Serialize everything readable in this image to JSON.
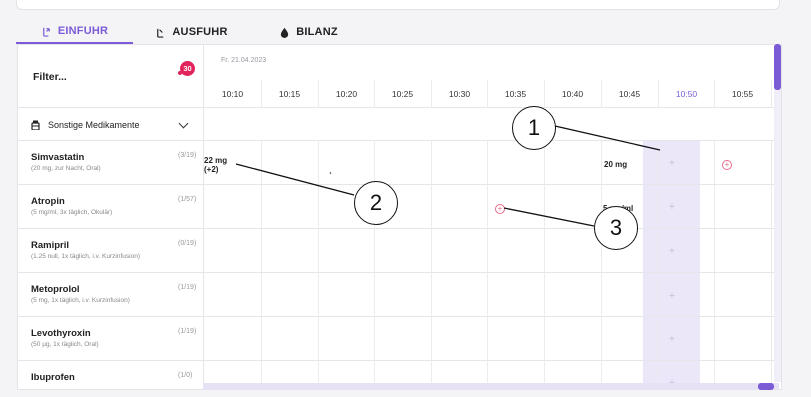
{
  "tabs": [
    {
      "label": "EINFUHR",
      "icon": "intake-icon",
      "active": true
    },
    {
      "label": "AUSFUHR",
      "icon": "output-icon",
      "active": false
    },
    {
      "label": "BILANZ",
      "icon": "drop-icon",
      "active": false
    }
  ],
  "filter": {
    "label": "Filter...",
    "badge": "30"
  },
  "date": "Fr. 21.04.2023",
  "times": [
    "10:10",
    "10:15",
    "10:20",
    "10:25",
    "10:30",
    "10:35",
    "10:40",
    "10:45",
    "10:50",
    "10:55"
  ],
  "active_time": "10:50",
  "group": {
    "label": "Sonstige Medikamente",
    "icon": "medicine-bottle-icon"
  },
  "medications": [
    {
      "name": "Simvastatin",
      "detail": "(20 mg, zur Nacht, Oral)",
      "count": "(3/19)"
    },
    {
      "name": "Atropin",
      "detail": "(5 mg/ml, 3x täglich, Okulär)",
      "count": "(1/57)"
    },
    {
      "name": "Ramipril",
      "detail": "(1.25 null, 1x täglich, i.v. Kurzinfusion)",
      "count": "(0/19)"
    },
    {
      "name": "Metoprolol",
      "detail": "(5 mg, 1x täglich, i.v. Kurzinfusion)",
      "count": "(1/19)"
    },
    {
      "name": "Levothyroxin",
      "detail": "(50 µg, 1x täglich, Oral)",
      "count": "(1/19)"
    },
    {
      "name": "Ibuprofen",
      "detail": "",
      "count": "(1/0)"
    }
  ],
  "cells": {
    "simvastatin_1010": "22 mg",
    "simvastatin_1010_extra": "(+2)",
    "simvastatin_1045": "20 mg",
    "atropin_1045": "5 mg/ml"
  },
  "callouts": [
    "1",
    "2",
    "3"
  ]
}
